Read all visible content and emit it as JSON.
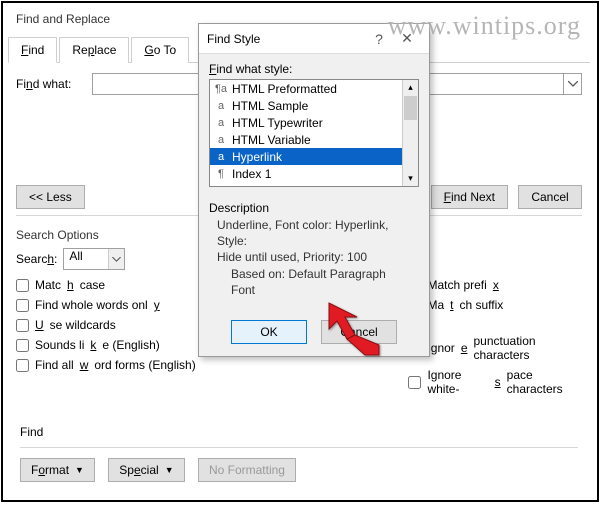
{
  "watermark": "www.wintips.org",
  "main": {
    "title": "Find and Replace",
    "tabs": {
      "find": "Find",
      "replace": "Replace",
      "goto": "Go To"
    },
    "find_what_label": "Find what:",
    "less_btn": "<< Less",
    "find_next_btn": "Find Next",
    "cancel_btn": "Cancel",
    "search_options_title": "Search Options",
    "search_label": "Search:",
    "search_value": "All",
    "checks": {
      "match_case": "Match case",
      "whole_words": "Find whole words only",
      "wildcards": "Use wildcards",
      "sounds_like": "Sounds like (English)",
      "word_forms": "Find all word forms (English)",
      "prefix": "Match prefix",
      "suffix": "Match suffix",
      "punctuation": "Ignore punctuation characters",
      "whitespace": "Ignore white-space characters"
    },
    "find_section_label": "Find",
    "format_btn": "Format",
    "special_btn": "Special",
    "no_formatting_btn": "No Formatting"
  },
  "style": {
    "title": "Find Style",
    "list_label": "Find what style:",
    "items": [
      {
        "icon": "¶a",
        "label": "HTML Preformatted"
      },
      {
        "icon": "a",
        "label": "HTML Sample"
      },
      {
        "icon": "a",
        "label": "HTML Typewriter"
      },
      {
        "icon": "a",
        "label": "HTML Variable"
      },
      {
        "icon": "a",
        "label": "Hyperlink",
        "selected": true
      },
      {
        "icon": "¶",
        "label": "Index 1"
      }
    ],
    "desc_label": "Description",
    "desc_line1": "Underline, Font color: Hyperlink, Style:",
    "desc_line2": "Hide until used, Priority: 100",
    "desc_line3": "Based on: Default Paragraph Font",
    "ok_btn": "OK",
    "cancel_btn": "Cancel"
  }
}
